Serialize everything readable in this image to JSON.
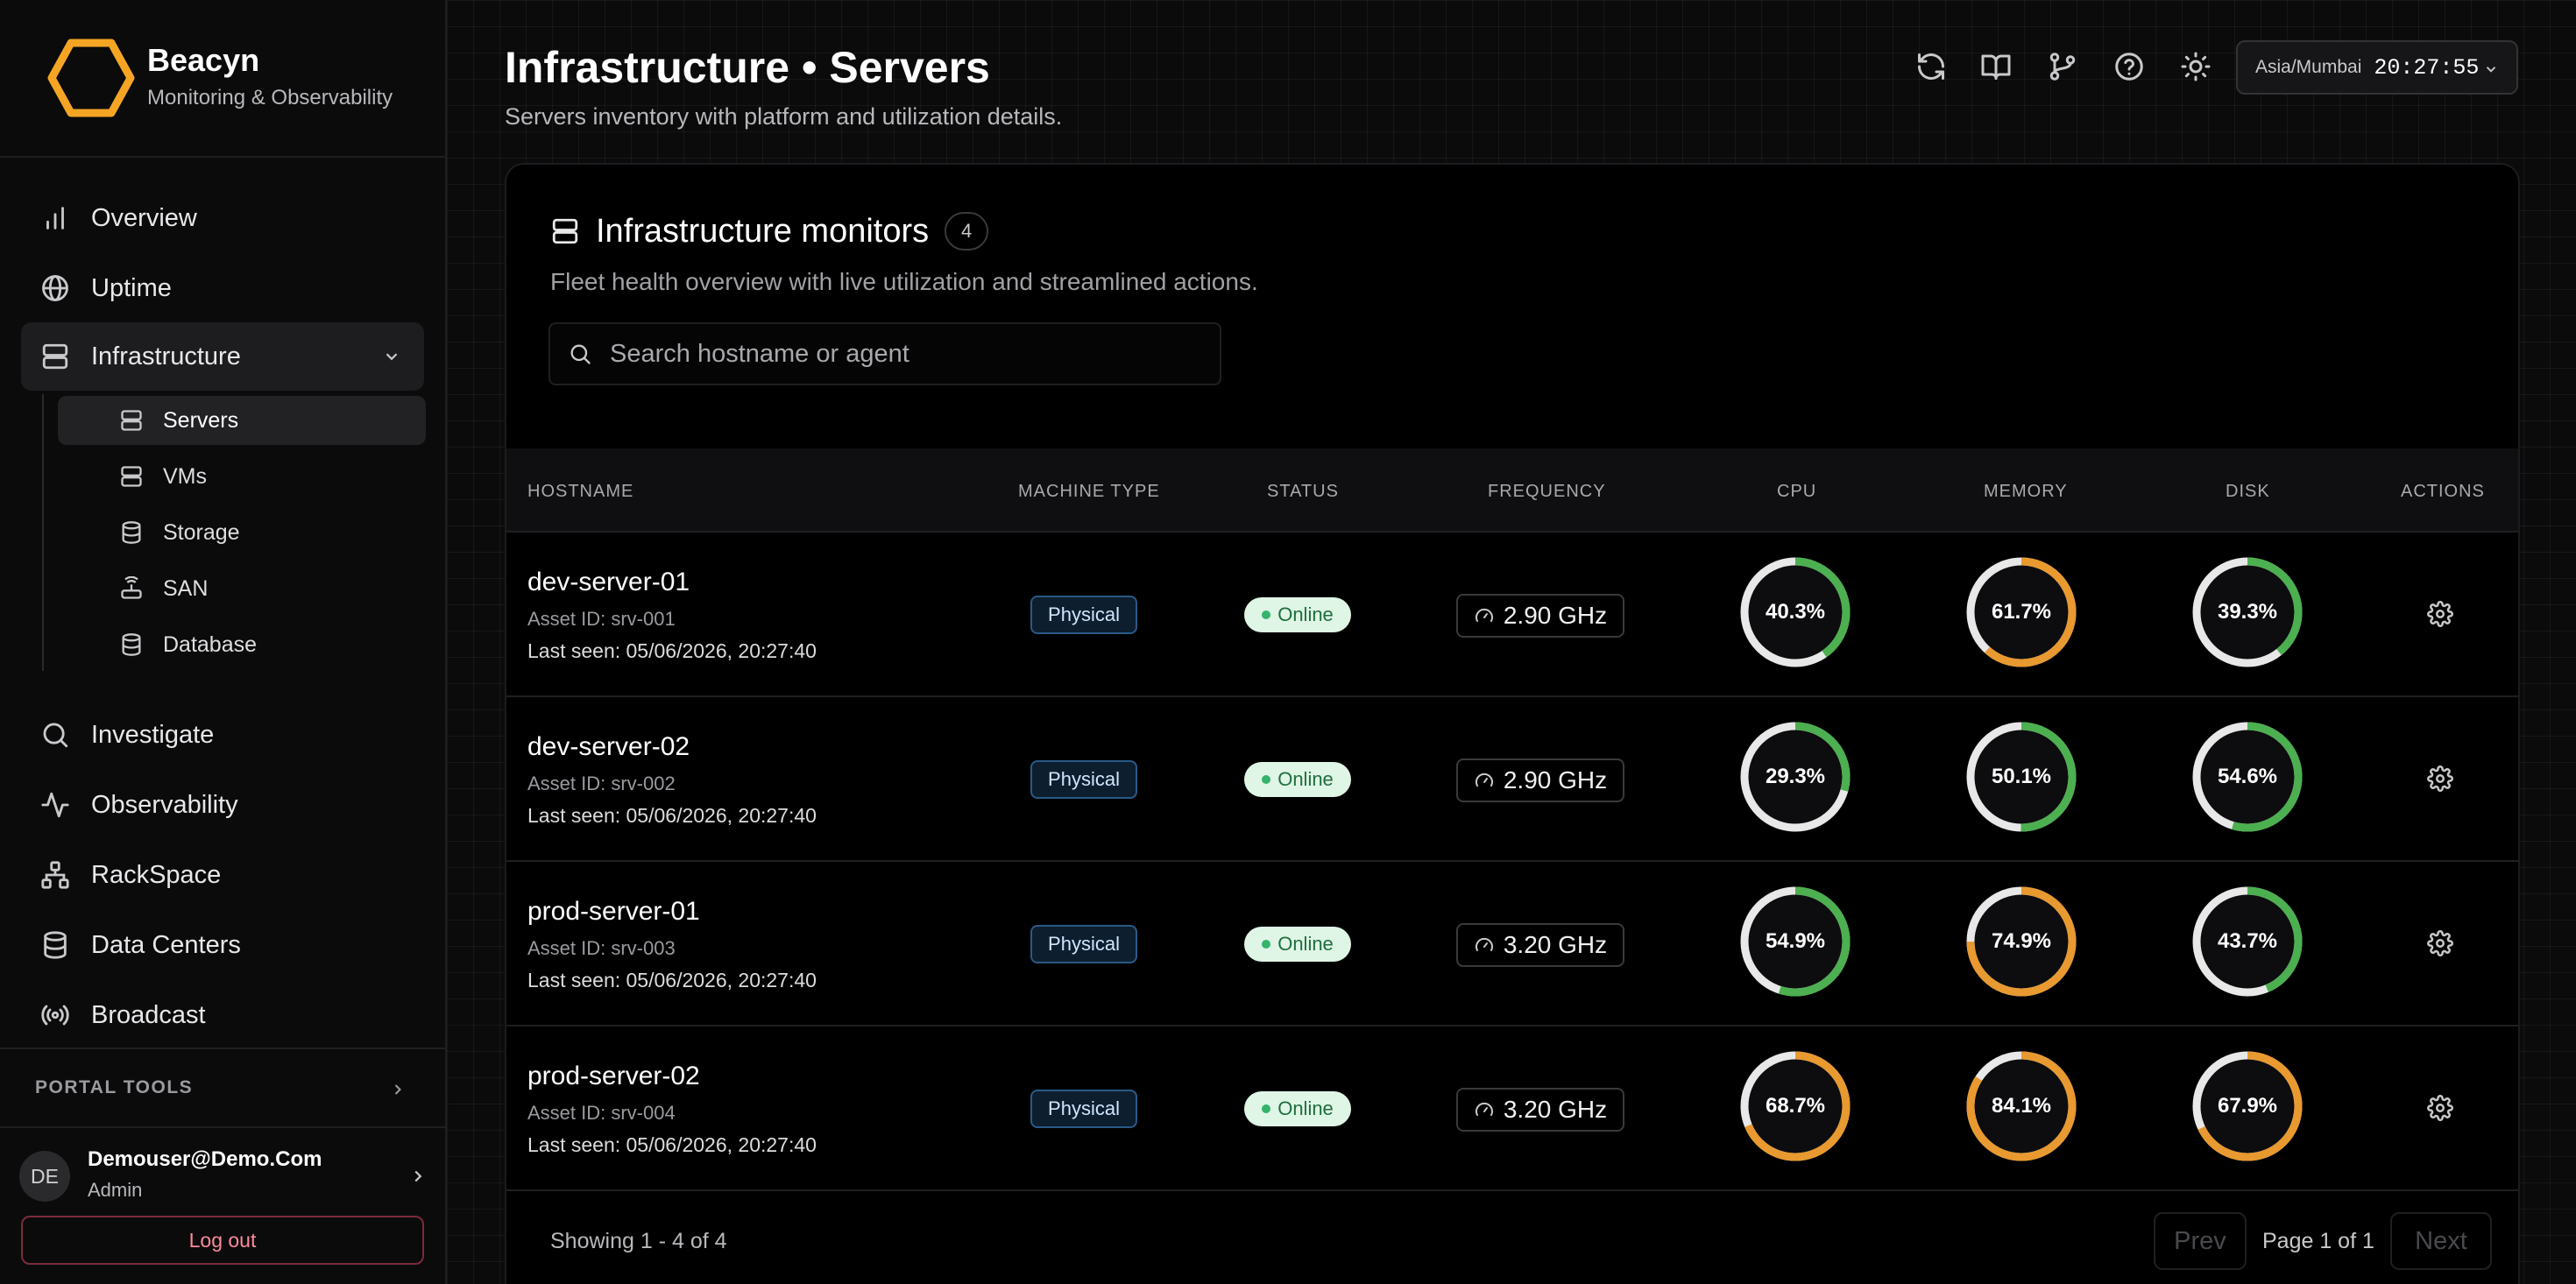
{
  "brand": {
    "name": "Beacyn",
    "subtitle": "Monitoring & Observability",
    "accent": "#f5a524"
  },
  "sidebar": {
    "items": [
      {
        "label": "Overview",
        "icon": "bar-chart-icon"
      },
      {
        "label": "Uptime",
        "icon": "globe-icon"
      },
      {
        "label": "Infrastructure",
        "icon": "server-icon"
      },
      {
        "label": "Investigate",
        "icon": "search-icon"
      },
      {
        "label": "Observability",
        "icon": "activity-icon"
      },
      {
        "label": "RackSpace",
        "icon": "network-icon"
      },
      {
        "label": "Data Centers",
        "icon": "database-icon"
      },
      {
        "label": "Broadcast",
        "icon": "broadcast-icon"
      }
    ],
    "subitems": [
      {
        "label": "Servers",
        "icon": "server-icon"
      },
      {
        "label": "VMs",
        "icon": "server-icon"
      },
      {
        "label": "Storage",
        "icon": "database-icon"
      },
      {
        "label": "SAN",
        "icon": "router-icon"
      },
      {
        "label": "Database",
        "icon": "database-icon"
      }
    ],
    "portal_tools": "PORTAL TOOLS",
    "user": {
      "initials": "DE",
      "name": "Demouser@Demo.Com",
      "role": "Admin"
    },
    "logout": "Log out"
  },
  "header": {
    "title": "Infrastructure • Servers",
    "subtitle": "Servers inventory with platform and utilization details.",
    "timezone": "Asia/Mumbai",
    "time": "20:27:55"
  },
  "card": {
    "title": "Infrastructure monitors",
    "count": "4",
    "subtitle": "Fleet health overview with live utilization and streamlined actions.",
    "search_placeholder": "Search hostname or agent"
  },
  "table": {
    "headers": [
      "HOSTNAME",
      "MACHINE TYPE",
      "STATUS",
      "FREQUENCY",
      "CPU",
      "MEMORY",
      "DISK",
      "ACTIONS"
    ],
    "rows": [
      {
        "hostname": "dev-server-01",
        "asset": "Asset ID: srv-001",
        "seen": "Last seen: 05/06/2026, 20:27:40",
        "type": "Physical",
        "status": "Online",
        "freq": "2.90 GHz",
        "cpu": 40.3,
        "cpu_label": "40.3%",
        "mem": 61.7,
        "mem_label": "61.7%",
        "disk": 39.3,
        "disk_label": "39.3%"
      },
      {
        "hostname": "dev-server-02",
        "asset": "Asset ID: srv-002",
        "seen": "Last seen: 05/06/2026, 20:27:40",
        "type": "Physical",
        "status": "Online",
        "freq": "2.90 GHz",
        "cpu": 29.3,
        "cpu_label": "29.3%",
        "mem": 50.1,
        "mem_label": "50.1%",
        "disk": 54.6,
        "disk_label": "54.6%"
      },
      {
        "hostname": "prod-server-01",
        "asset": "Asset ID: srv-003",
        "seen": "Last seen: 05/06/2026, 20:27:40",
        "type": "Physical",
        "status": "Online",
        "freq": "3.20 GHz",
        "cpu": 54.9,
        "cpu_label": "54.9%",
        "mem": 74.9,
        "mem_label": "74.9%",
        "disk": 43.7,
        "disk_label": "43.7%"
      },
      {
        "hostname": "prod-server-02",
        "asset": "Asset ID: srv-004",
        "seen": "Last seen: 05/06/2026, 20:27:40",
        "type": "Physical",
        "status": "Online",
        "freq": "3.20 GHz",
        "cpu": 68.7,
        "cpu_label": "68.7%",
        "mem": 84.1,
        "mem_label": "84.1%",
        "disk": 67.9,
        "disk_label": "67.9%"
      }
    ]
  },
  "footer": {
    "showing": "Showing 1 - 4 of 4",
    "prev": "Prev",
    "page": "Page 1 of 1",
    "next": "Next"
  },
  "colors": {
    "gauge_ok": "#4caf50",
    "gauge_warn": "#e8992f",
    "gauge_track": "#e8e8e8"
  }
}
